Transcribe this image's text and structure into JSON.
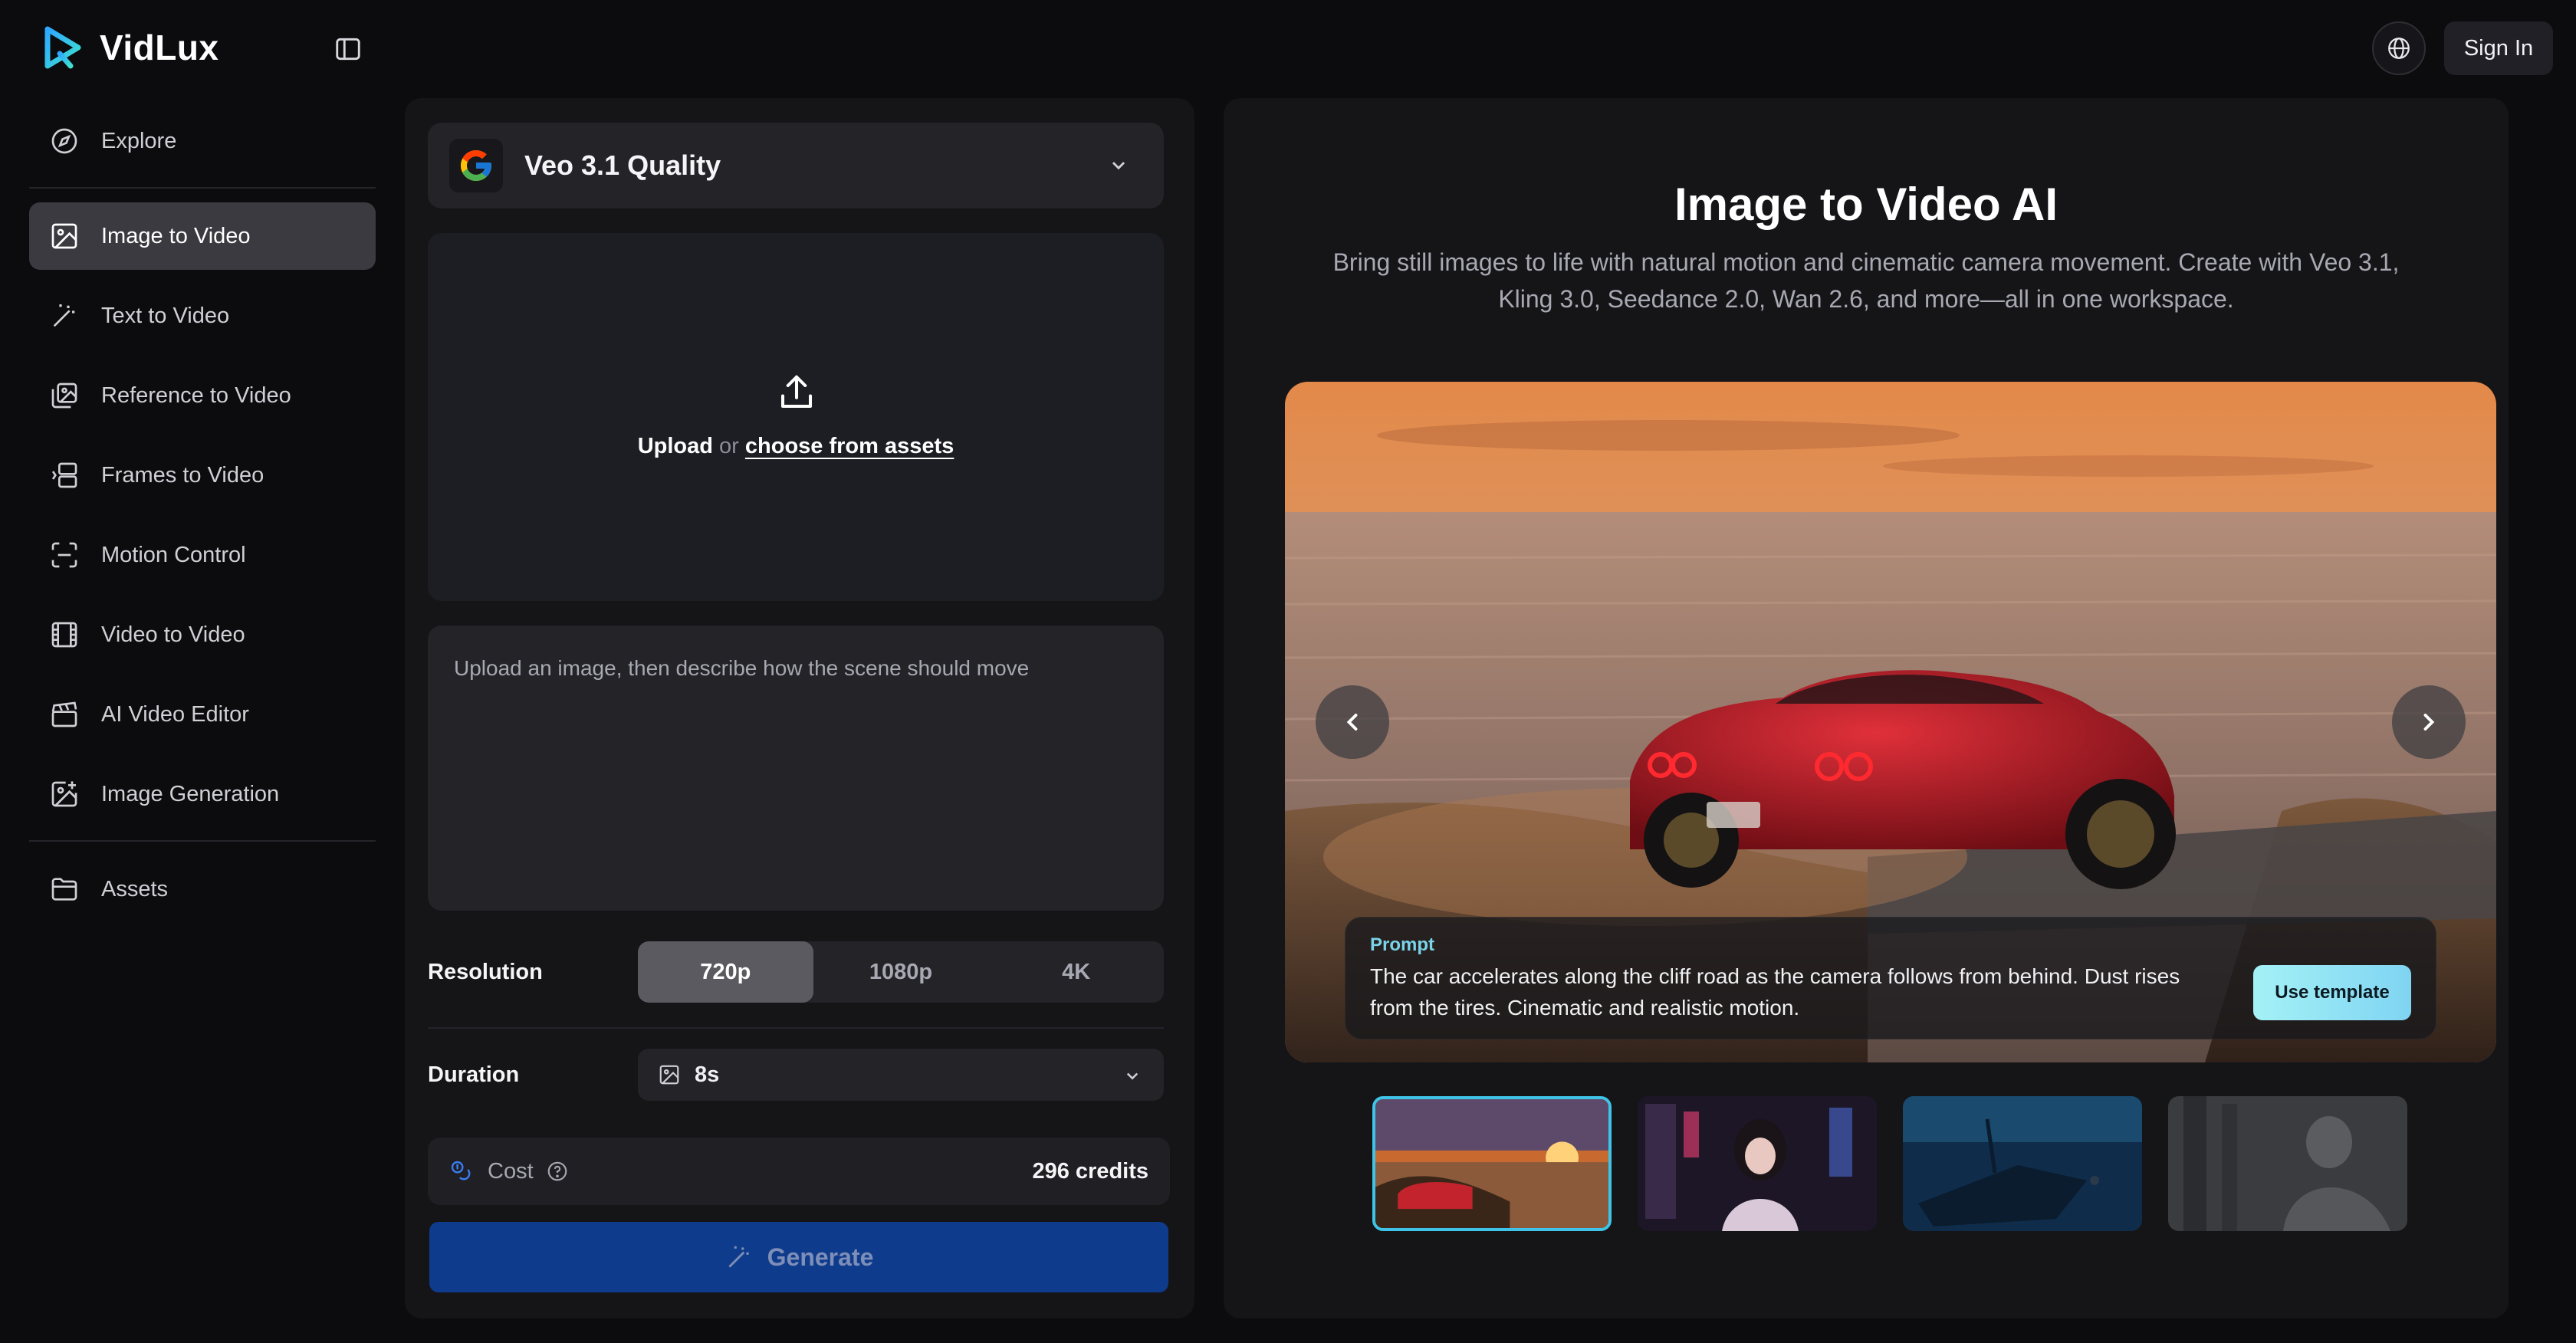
{
  "app": {
    "name": "VidLux",
    "colors": {
      "accent": "#3ec4e8",
      "primary_button": "#0f3b8c",
      "background": "#0c0c0e",
      "panel": "#151518"
    }
  },
  "header": {
    "collapse_icon": "sidebar-toggle-icon",
    "language_icon": "globe-icon",
    "sign_in_label": "Sign In"
  },
  "sidebar": {
    "items": [
      {
        "label": "Explore",
        "icon": "compass-icon"
      },
      {
        "label": "Image to Video",
        "icon": "image-icon",
        "active": true
      },
      {
        "label": "Text to Video",
        "icon": "magic-wand-icon"
      },
      {
        "label": "Reference to Video",
        "icon": "reference-image-icon"
      },
      {
        "label": "Frames to Video",
        "icon": "frames-icon"
      },
      {
        "label": "Motion Control",
        "icon": "scan-icon"
      },
      {
        "label": "Video to Video",
        "icon": "film-icon"
      },
      {
        "label": "AI Video Editor",
        "icon": "clapperboard-icon"
      },
      {
        "label": "Image Generation",
        "icon": "image-plus-icon"
      },
      {
        "label": "Assets",
        "icon": "folder-icon"
      }
    ]
  },
  "generator": {
    "model": {
      "name": "Veo 3.1 Quality",
      "logo": "google-logo-icon"
    },
    "upload": {
      "upload_label": "Upload",
      "or_label": "or",
      "assets_link": "choose from assets"
    },
    "prompt_placeholder": "Upload an image, then describe how the scene should move",
    "resolution": {
      "label": "Resolution",
      "options": [
        "720p",
        "1080p",
        "4K"
      ],
      "selected": "720p"
    },
    "duration": {
      "label": "Duration",
      "value": "8s"
    },
    "cost": {
      "label": "Cost",
      "value": "296 credits"
    },
    "generate_label": "Generate"
  },
  "showcase": {
    "title": "Image to Video AI",
    "subtitle": "Bring still images to life with natural motion and cinematic camera movement. Create with Veo 3.1, Kling 3.0, Seedance 2.0, Wan 2.6, and more—all in one workspace.",
    "prompt_label": "Prompt",
    "prompt_text": "The car accelerates along the cliff road as the camera follows from behind. Dust rises from the tires. Cinematic and realistic motion.",
    "use_template_label": "Use template",
    "thumbnails": [
      "sunset-car",
      "neon-city-girl",
      "underwater-shipwreck",
      "stone-warrior"
    ],
    "active_thumbnail": 0
  }
}
